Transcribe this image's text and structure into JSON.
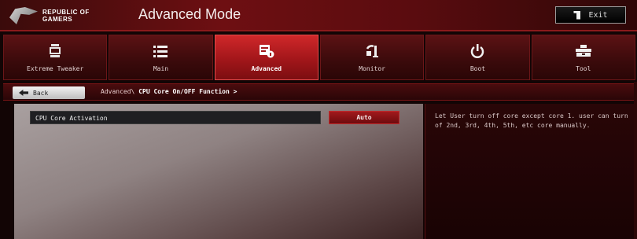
{
  "header": {
    "brand_line1": "REPUBLIC OF",
    "brand_line2": "GAMERS",
    "mode_title": "Advanced Mode",
    "exit_label": "Exit"
  },
  "tabs": [
    {
      "label": "Extreme Tweaker",
      "icon": "tweaker-icon",
      "active": false
    },
    {
      "label": "Main",
      "icon": "list-icon",
      "active": false
    },
    {
      "label": "Advanced",
      "icon": "advanced-icon",
      "active": true
    },
    {
      "label": "Monitor",
      "icon": "monitor-icon",
      "active": false
    },
    {
      "label": "Boot",
      "icon": "power-icon",
      "active": false
    },
    {
      "label": "Tool",
      "icon": "tool-icon",
      "active": false
    }
  ],
  "breadcrumb": {
    "back_label": "Back",
    "path_prefix": "Advanced\\",
    "path_current": "CPU Core On/OFF Function >"
  },
  "settings": [
    {
      "label": "CPU Core Activation",
      "value": "Auto"
    }
  ],
  "help": {
    "text": "Let User turn off core except core 1. user can turn of 2nd, 3rd, 4th, 5th, etc core manually."
  },
  "colors": {
    "accent_red": "#c02a2c",
    "active_tab": "#d0282a",
    "header_bg": "#6e0f12"
  }
}
